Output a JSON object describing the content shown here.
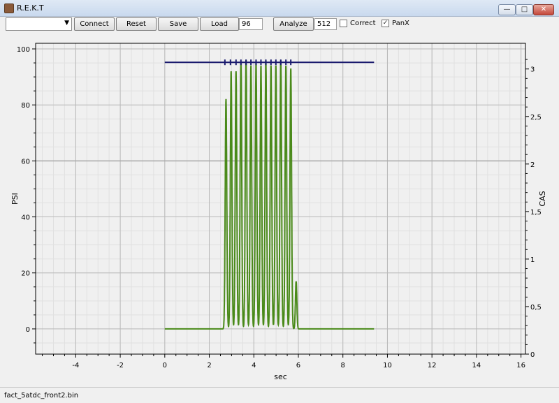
{
  "window": {
    "title": "R.E.K.T",
    "icon": "app-icon",
    "buttons": {
      "minimize": "—",
      "maximize": "□",
      "close": "✕"
    }
  },
  "toolbar": {
    "combo_value": "",
    "connect_label": "Connect",
    "reset_label": "Reset",
    "save_label": "Save",
    "load_label": "Load",
    "load_value": "96",
    "analyze_label": "Analyze",
    "analyze_value": "512",
    "correct_label": "Correct",
    "correct_checked": false,
    "panx_label": "PanX",
    "panx_checked": true
  },
  "chart_data": {
    "type": "line",
    "xlabel": "sec",
    "ylabel": "PSI",
    "y2label": "CAS",
    "xlim": [
      -5.8,
      16.2
    ],
    "ylim": [
      -9,
      102
    ],
    "y2lim": [
      0,
      3.27
    ],
    "xticks": [
      "-4",
      "-2",
      "0",
      "2",
      "4",
      "6",
      "8",
      "10",
      "12",
      "14",
      "16"
    ],
    "yticks": [
      "0",
      "20",
      "40",
      "60",
      "80",
      "100"
    ],
    "y2ticks": [
      "0",
      "0,5",
      "1",
      "1,5",
      "2",
      "2,5",
      "3"
    ],
    "grid": true,
    "series": [
      {
        "color": "#4a8a1a",
        "baseline": 0,
        "x_start": 0,
        "x_end": 9.4,
        "peaks": [
          {
            "x": 2.75,
            "y": 82
          },
          {
            "x": 2.98,
            "y": 92
          },
          {
            "x": 3.2,
            "y": 92
          },
          {
            "x": 3.42,
            "y": 95
          },
          {
            "x": 3.65,
            "y": 96
          },
          {
            "x": 3.87,
            "y": 94
          },
          {
            "x": 4.1,
            "y": 95
          },
          {
            "x": 4.32,
            "y": 94
          },
          {
            "x": 4.54,
            "y": 96
          },
          {
            "x": 4.77,
            "y": 94
          },
          {
            "x": 4.99,
            "y": 94
          },
          {
            "x": 5.21,
            "y": 96
          },
          {
            "x": 5.44,
            "y": 94
          },
          {
            "x": 5.66,
            "y": 93
          },
          {
            "x": 5.9,
            "y": 17
          }
        ]
      },
      {
        "color": "#1a1a6e",
        "axis": "right",
        "y": 3.07,
        "x_start": 0,
        "x_end": 9.4,
        "markers_x": [
          2.7,
          2.95,
          3.2,
          3.42,
          3.65,
          3.87,
          4.1,
          4.32,
          4.54,
          4.77,
          4.99,
          5.21,
          5.44,
          5.66
        ]
      }
    ]
  },
  "status": {
    "filename": "fact_5atdc_front2.bin"
  }
}
